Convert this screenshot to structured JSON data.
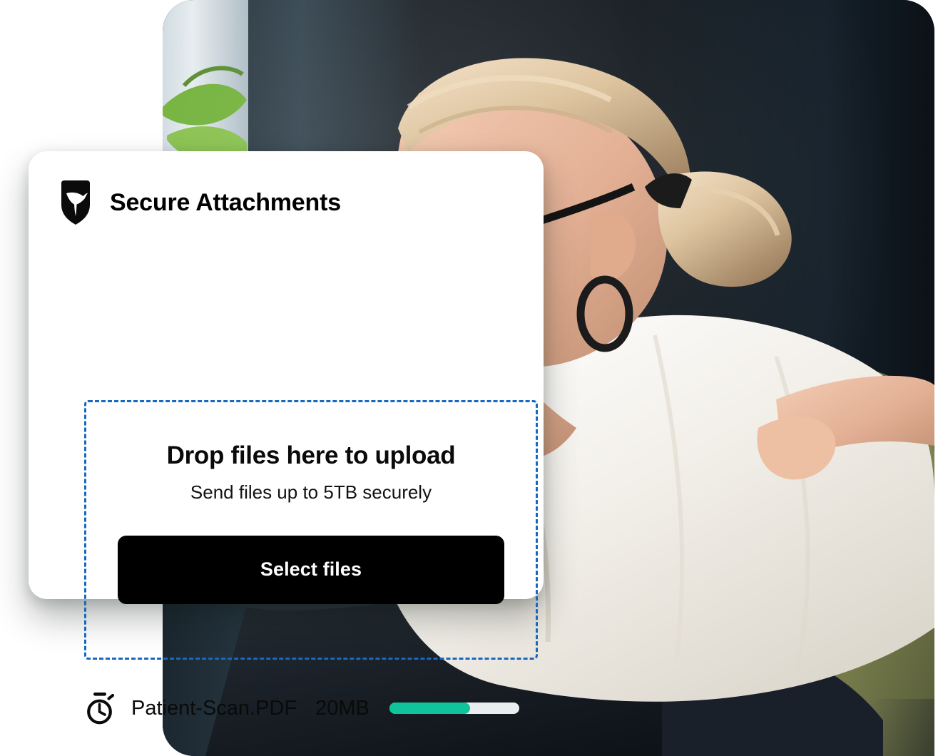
{
  "card": {
    "logo_icon": "shield-bird-icon",
    "title": "Secure Attachments",
    "dropzone": {
      "title": "Drop files here to upload",
      "subtitle": "Send files up to 5TB securely",
      "button_label": "Select files",
      "border_color": "#1769c0"
    },
    "file": {
      "status_icon": "stopwatch-icon",
      "name": "Patient-Scan.PDF",
      "size": "20MB",
      "progress_percent": 62,
      "progress_color": "#0fc39a",
      "track_color": "#e9edf0"
    }
  },
  "photo": {
    "alt": "Smiling woman with glasses seated holding a tablet"
  },
  "colors": {
    "card_background": "#ffffff",
    "button_background": "#000000",
    "button_text": "#ffffff",
    "text_primary": "#0a0a0a",
    "photo_background": "#131c24"
  }
}
